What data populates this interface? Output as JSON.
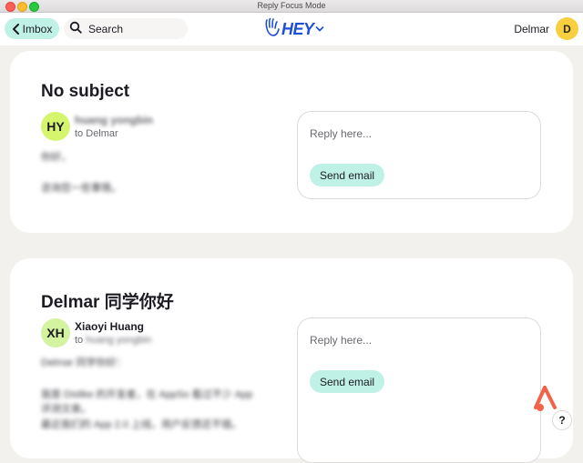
{
  "window": {
    "title": "Reply Focus Mode"
  },
  "header": {
    "back_label": "Imbox",
    "search_label": "Search",
    "logo_text": "HEY",
    "user_name": "Delmar",
    "user_initial": "D"
  },
  "emails": [
    {
      "subject": "No subject",
      "sender_initials": "HY",
      "sender_name": "huang yongbin",
      "to_prefix": "to",
      "to_name": "Delmar",
      "body": [
        "你好，",
        "咨询您一些事情。"
      ],
      "reply_placeholder": "Reply here...",
      "send_label": "Send email"
    },
    {
      "subject": "Delmar 同学你好",
      "sender_initials": "XH",
      "sender_name": "Xiaoyi Huang",
      "to_prefix": "to",
      "to_name": "huang yongbin",
      "body": [
        "Delmar 同学你好：",
        "我是 Dislike 的开发者，在 AppSo 看过不少 App",
        "评测文章。",
        "最近我们的 App 2.0 上线，用户反馈还不错。"
      ],
      "reply_placeholder": "Reply here...",
      "send_label": "Send email"
    }
  ],
  "help": {
    "label": "?"
  },
  "colors": {
    "accent": "#bff1e6",
    "brand_blue": "#1e4fd8",
    "avatar_user": "#f8cf3e"
  }
}
